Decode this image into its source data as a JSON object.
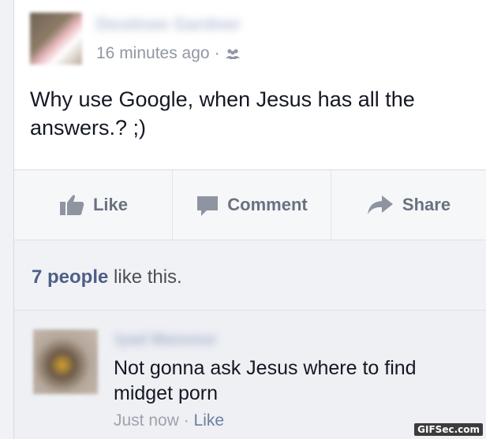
{
  "post": {
    "author_name": "Destinee Gardner",
    "timestamp": "16 minutes ago",
    "separator": "·",
    "audience_icon": "friends-icon",
    "text": "Why use Google, when Jesus has all the answers.? ;)"
  },
  "actions": {
    "like_label": "Like",
    "comment_label": "Comment",
    "share_label": "Share",
    "like_icon": "thumbs-up-icon",
    "comment_icon": "speech-bubble-icon",
    "share_icon": "share-arrow-icon"
  },
  "likes": {
    "count_text": "7 people",
    "suffix_text": " like this."
  },
  "comment": {
    "author_name": "Iyad Mansour",
    "text": "Not gonna ask Jesus where to find midget porn",
    "timestamp": "Just now",
    "separator": " · ",
    "like_label": "Like"
  },
  "watermark": "GIFSec.com",
  "colors": {
    "link_blue": "#4e5f86",
    "text_dark": "#141823",
    "meta_gray": "#9197a3",
    "action_gray": "#6a7180",
    "background": "#eef0f4"
  }
}
